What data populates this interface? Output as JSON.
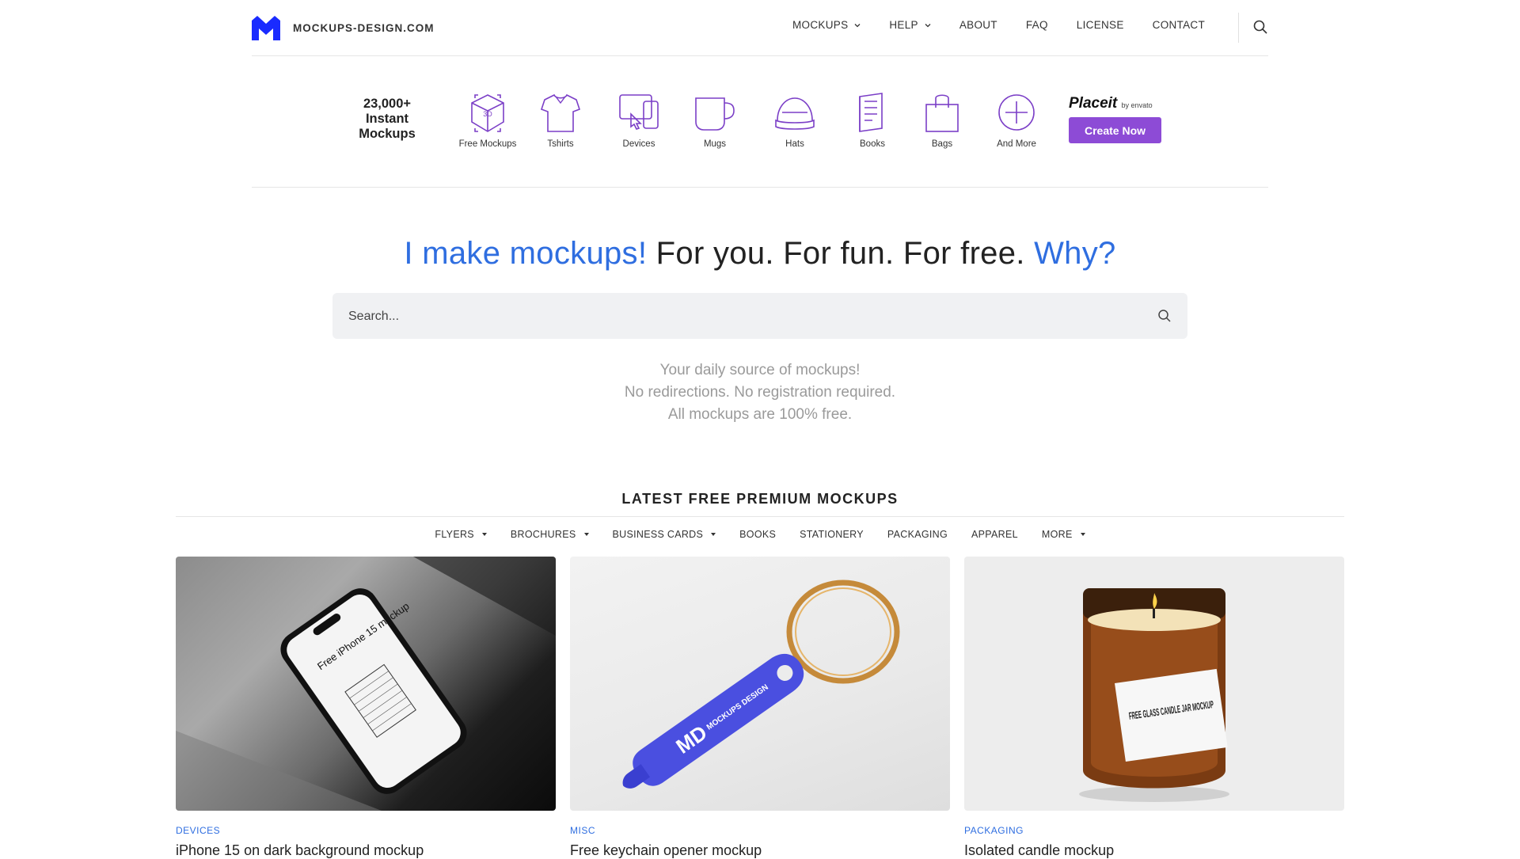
{
  "brand": {
    "name": "MOCKUPS-DESIGN.COM"
  },
  "nav": {
    "items": [
      "MOCKUPS",
      "HELP",
      "ABOUT",
      "FAQ",
      "LICENSE",
      "CONTACT"
    ]
  },
  "strip": {
    "count_lines": [
      "23,000+",
      "Instant",
      "Mockups"
    ],
    "categories": [
      "Free Mockups",
      "Tshirts",
      "Devices",
      "Mugs",
      "Hats",
      "Books",
      "Bags",
      "And More"
    ],
    "placeit_logo": "Placeit",
    "placeit_by": "by envato",
    "cta": "Create Now"
  },
  "hero": {
    "part1": "I make mockups!",
    "part2": " For you. For fun. For free. ",
    "part3": "Why?"
  },
  "search": {
    "placeholder": "Search..."
  },
  "tagline": [
    "Your daily source of mockups!",
    "No redirections. No registration required.",
    "All mockups are 100% free."
  ],
  "latest": {
    "title": "LATEST FREE PREMIUM MOCKUPS",
    "filters": [
      {
        "label": "FLYERS",
        "dropdown": true
      },
      {
        "label": "BROCHURES",
        "dropdown": true
      },
      {
        "label": "BUSINESS CARDS",
        "dropdown": true
      },
      {
        "label": "BOOKS",
        "dropdown": false
      },
      {
        "label": "STATIONERY",
        "dropdown": false
      },
      {
        "label": "PACKAGING",
        "dropdown": false
      },
      {
        "label": "APPAREL",
        "dropdown": false
      },
      {
        "label": "MORE",
        "dropdown": true
      }
    ]
  },
  "cards": [
    {
      "category": "DEVICES",
      "title": "iPhone 15 on dark background mockup",
      "screen_text": "Free iPhone 15 mockup"
    },
    {
      "category": "MISC",
      "title": "Free keychain opener mockup",
      "brand_text": "MOCKUPS DESIGN"
    },
    {
      "category": "PACKAGING",
      "title": "Isolated candle mockup",
      "label_text": "FREE GLASS CANDLE JAR MOCKUP"
    }
  ],
  "colors": {
    "accent": "#2f6ee0",
    "placeit": "#8d4bd6",
    "brand": "#1a2bff"
  }
}
